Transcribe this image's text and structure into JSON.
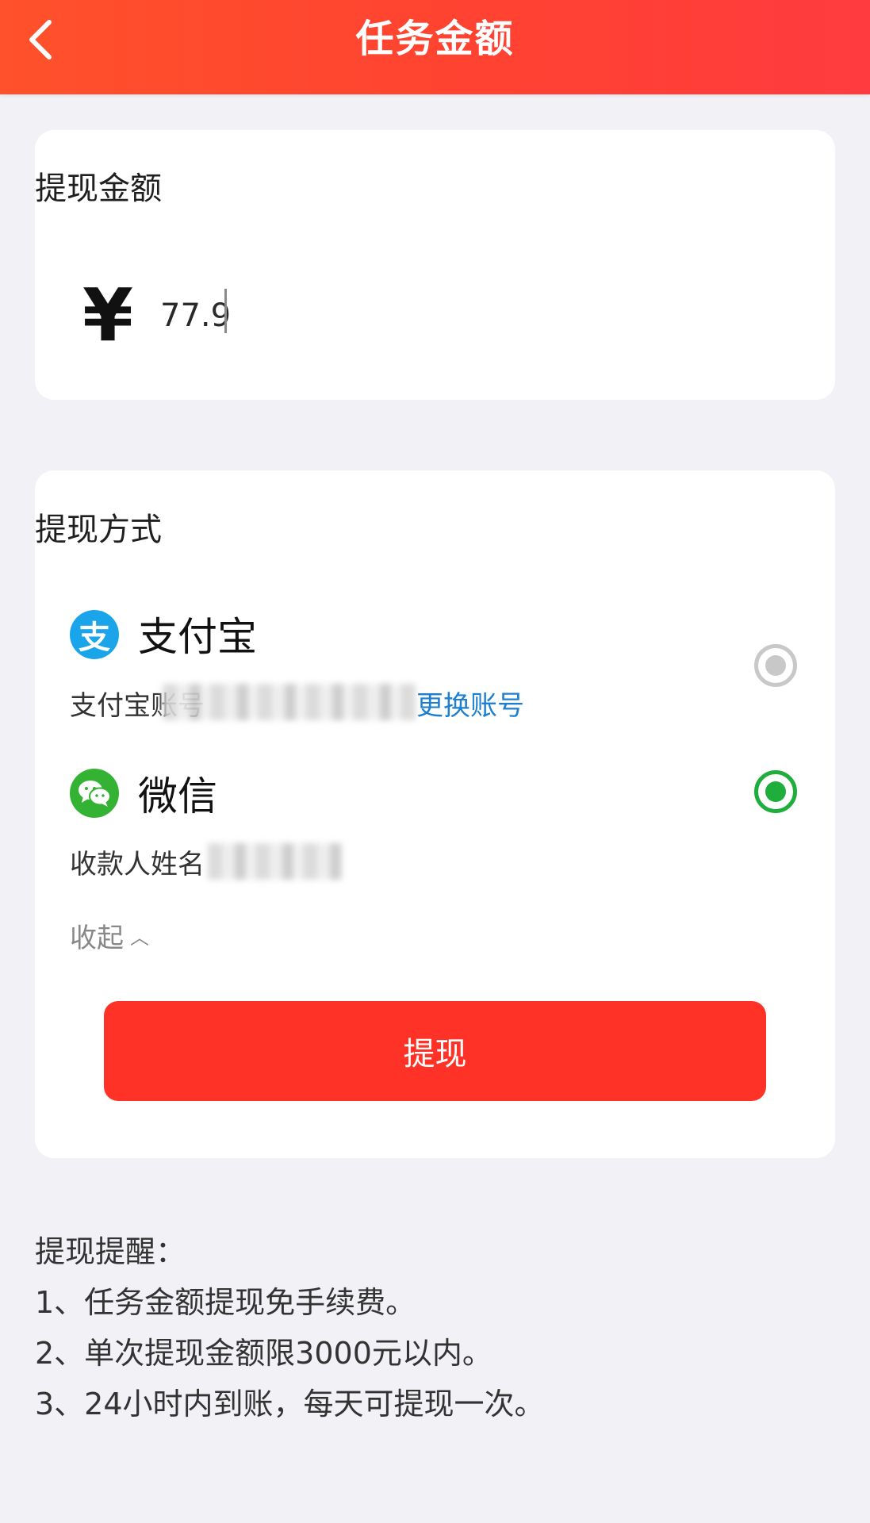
{
  "header": {
    "title": "任务金额"
  },
  "amount_card": {
    "title": "提现金额",
    "currency_symbol": "¥",
    "amount_value": "77.9"
  },
  "method_card": {
    "title": "提现方式",
    "options": [
      {
        "name": "支付宝",
        "icon": "alipay-icon",
        "account_label": "支付宝账号",
        "change_account": "更换账号",
        "selected": false
      },
      {
        "name": "微信",
        "icon": "wechat-icon",
        "payee_label": "收款人姓名",
        "selected": true
      }
    ],
    "collapse_label": "收起",
    "withdraw_button": "提现"
  },
  "notes": {
    "title": "提现提醒：",
    "items": [
      "1、任务金额提现免手续费。",
      "2、单次提现金额限3000元以内。",
      "3、24小时内到账，每天可提现一次。"
    ]
  },
  "colors": {
    "header_red": "#ff4231",
    "button_red": "#ff3227",
    "wechat_green": "#1fad3c",
    "alipay_blue": "#1aa5ea",
    "link_blue": "#1d7fd0"
  }
}
